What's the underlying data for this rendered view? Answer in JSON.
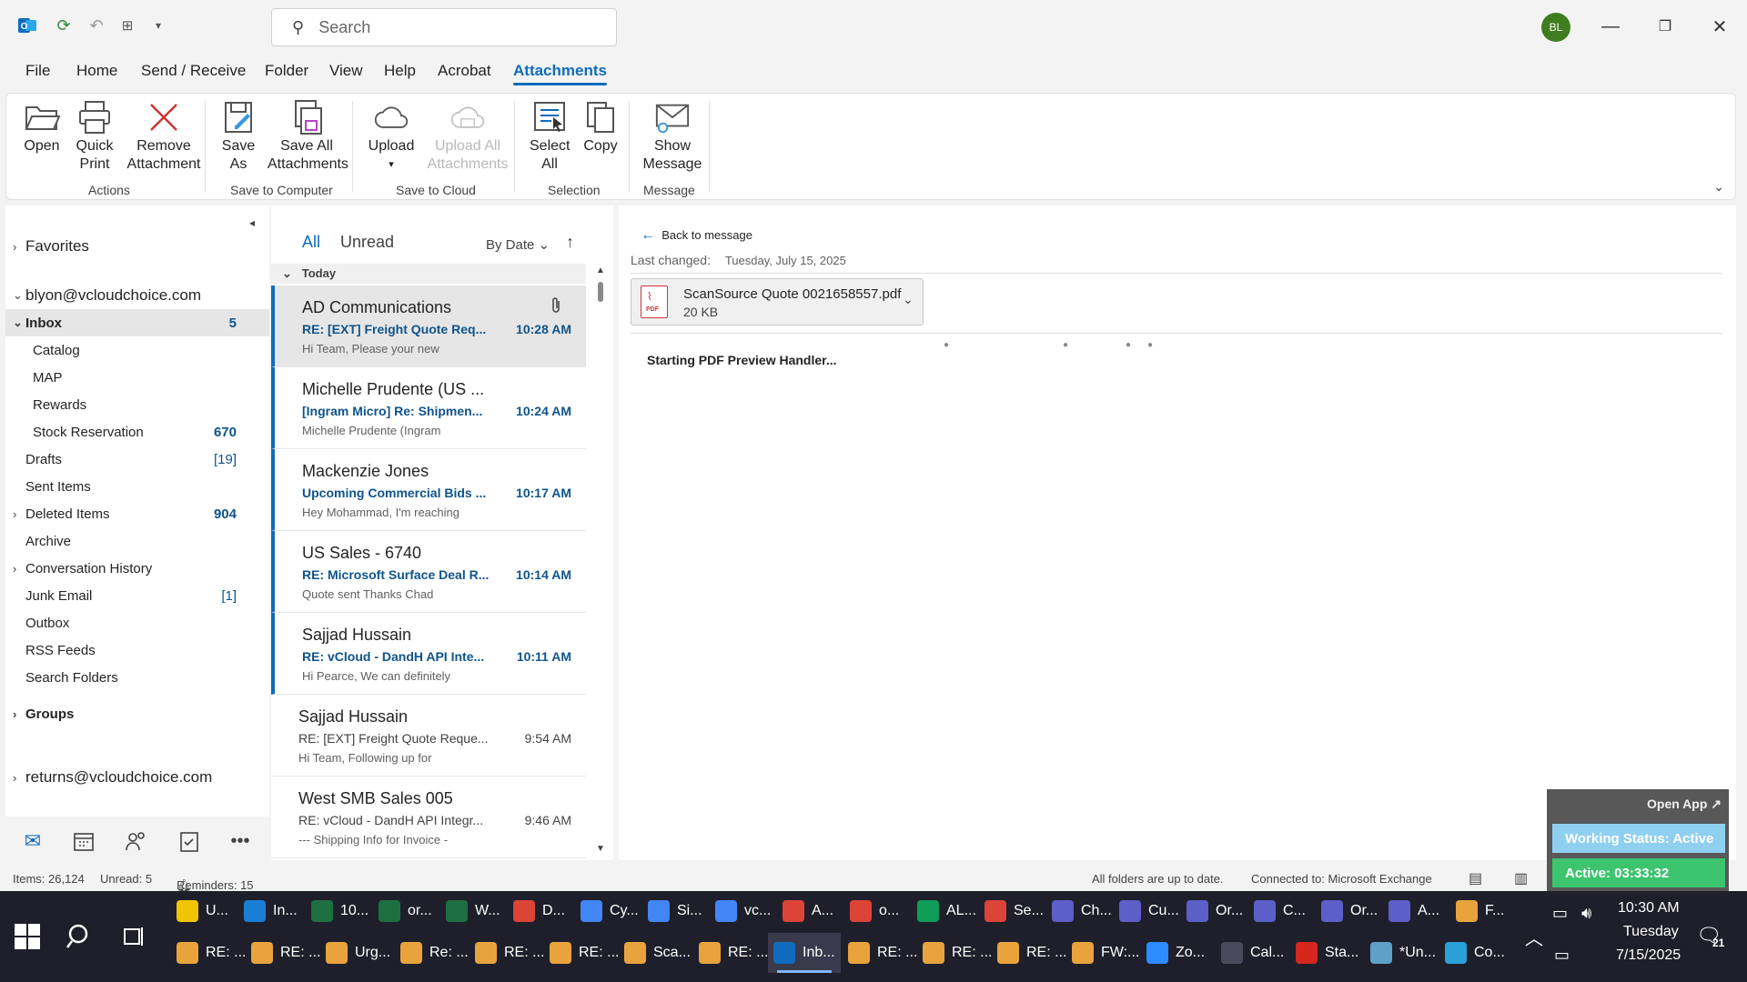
{
  "app": {
    "search_placeholder": "Search",
    "avatar_initials": "BL",
    "accent": "#0f6cbd"
  },
  "menu": [
    "File",
    "Home",
    "Send / Receive",
    "Folder",
    "View",
    "Help",
    "Acrobat",
    "Attachments"
  ],
  "ribbon": {
    "buttons": [
      {
        "label": "Open",
        "icon": "folder-open-icon"
      },
      {
        "label": "Quick Print",
        "icon": "printer-icon"
      },
      {
        "label": "Remove Attachment",
        "icon": "remove-x-icon"
      },
      {
        "label": "Save As",
        "icon": "save-as-icon"
      },
      {
        "label": "Save All Attachments",
        "icon": "save-all-icon"
      },
      {
        "label": "Upload",
        "icon": "cloud-upload-icon"
      },
      {
        "label": "Upload All Attachments",
        "icon": "cloud-upload-all-icon"
      },
      {
        "label": "Select All",
        "icon": "select-all-icon"
      },
      {
        "label": "Copy",
        "icon": "copy-icon"
      },
      {
        "label": "Show Message",
        "icon": "show-message-icon"
      }
    ],
    "groups": [
      "Actions",
      "Save to Computer",
      "Save to Cloud",
      "Selection",
      "Message"
    ]
  },
  "folders": {
    "favorites": "Favorites",
    "account1": "blyon@vcloudchoice.com",
    "items": [
      {
        "label": "Inbox",
        "count": "5"
      },
      {
        "label": "Catalog",
        "count": ""
      },
      {
        "label": "MAP",
        "count": ""
      },
      {
        "label": "Rewards",
        "count": ""
      },
      {
        "label": "Stock Reservation",
        "count": "670"
      },
      {
        "label": "Drafts",
        "count": "[19]"
      },
      {
        "label": "Sent Items",
        "count": ""
      },
      {
        "label": "Deleted Items",
        "count": "904"
      },
      {
        "label": "Archive",
        "count": ""
      },
      {
        "label": "Conversation History",
        "count": ""
      },
      {
        "label": "Junk Email",
        "count": "[1]"
      },
      {
        "label": "Outbox",
        "count": ""
      },
      {
        "label": "RSS Feeds",
        "count": ""
      },
      {
        "label": "Search Folders",
        "count": ""
      }
    ],
    "groups": "Groups",
    "account2": "returns@vcloudchoice.com"
  },
  "list": {
    "tab_all": "All",
    "tab_unread": "Unread",
    "sort": "By Date",
    "group_header": "Today",
    "messages": [
      {
        "from": "AD Communications",
        "subject": "RE: [EXT] Freight Quote Req...",
        "time": "10:28 AM",
        "preview": "Hi Team,    Please your new"
      },
      {
        "from": "Michelle Prudente (US ...",
        "subject": "[Ingram Micro] Re: Shipmen...",
        "time": "10:24 AM",
        "preview": "Michelle Prudente (Ingram"
      },
      {
        "from": "Mackenzie Jones",
        "subject": "Upcoming Commercial Bids ...",
        "time": "10:17 AM",
        "preview": "Hey Mohammad,    I'm reaching"
      },
      {
        "from": "US Sales - 6740",
        "subject": "RE: Microsoft Surface Deal R...",
        "time": "10:14 AM",
        "preview": "Quote sent  Thanks  Chad"
      },
      {
        "from": "Sajjad Hussain",
        "subject": "RE: vCloud - DandH API Inte...",
        "time": "10:11 AM",
        "preview": "Hi Pearce,    We can definitely"
      },
      {
        "from": "Sajjad Hussain",
        "subject": "RE: [EXT] Freight Quote Reque...",
        "time": "9:54 AM",
        "preview": "Hi Team,    Following up for"
      },
      {
        "from": "West SMB Sales 005",
        "subject": "RE: vCloud - DandH API Integr...",
        "time": "9:46 AM",
        "preview": "--- Shipping Info for Invoice -"
      }
    ]
  },
  "reading": {
    "back": "Back to message",
    "last_changed_label": "Last changed:",
    "last_changed_value": "Tuesday, July 15, 2025",
    "file_name": "ScanSource Quote 0021658557.pdf",
    "file_size": "20 KB",
    "pdf_badge": "PDF",
    "handler": "Starting PDF Preview Handler..."
  },
  "status": {
    "items": "Items: 26,124",
    "unread": "Unread: 5",
    "reminders": "Reminders: 15",
    "sync": "All folders are up to date.",
    "connection": "Connected to: Microsoft Exchange"
  },
  "widget": {
    "open_app": "Open App ↗",
    "working": "Working Status: Active",
    "active": "Active: 03:33:32"
  },
  "taskbar": {
    "row1": [
      {
        "label": "U...",
        "icon": "file-explorer-icon",
        "color": "#f0c400"
      },
      {
        "label": "In...",
        "icon": "edge-icon",
        "color": "#1a7fd4"
      },
      {
        "label": "10...",
        "icon": "excel-icon",
        "color": "#1d6f42"
      },
      {
        "label": "or...",
        "icon": "excel-icon",
        "color": "#1d6f42"
      },
      {
        "label": "W...",
        "icon": "excel-icon",
        "color": "#1d6f42"
      },
      {
        "label": "D...",
        "icon": "chrome-icon",
        "color": "#db4437"
      },
      {
        "label": "Cy...",
        "icon": "chrome-icon",
        "color": "#4285f4"
      },
      {
        "label": "Si...",
        "icon": "chrome-icon",
        "color": "#4285f4"
      },
      {
        "label": "vc...",
        "icon": "chrome-icon",
        "color": "#4285f4"
      },
      {
        "label": "A...",
        "icon": "chrome-icon",
        "color": "#db4437"
      },
      {
        "label": "o...",
        "icon": "chrome-icon",
        "color": "#db4437"
      },
      {
        "label": "AL...",
        "icon": "chrome-icon",
        "color": "#0f9d58"
      },
      {
        "label": "Se...",
        "icon": "chrome-icon",
        "color": "#db4437"
      },
      {
        "label": "Ch...",
        "icon": "teams-icon",
        "color": "#5b5fc7"
      },
      {
        "label": "Cu...",
        "icon": "teams-icon",
        "color": "#5b5fc7"
      },
      {
        "label": "Or...",
        "icon": "teams-icon",
        "color": "#5b5fc7"
      },
      {
        "label": "C...",
        "icon": "teams-icon",
        "color": "#5b5fc7"
      },
      {
        "label": "Or...",
        "icon": "teams-icon",
        "color": "#5b5fc7"
      },
      {
        "label": "A...",
        "icon": "teams-icon",
        "color": "#5b5fc7"
      },
      {
        "label": "F...",
        "icon": "mail-icon",
        "color": "#e8a33d"
      }
    ],
    "row2": [
      {
        "label": "RE: ...",
        "icon": "mail-icon",
        "color": "#e8a33d"
      },
      {
        "label": "RE: ...",
        "icon": "mail-icon",
        "color": "#e8a33d"
      },
      {
        "label": "Urg...",
        "icon": "mail-icon",
        "color": "#e8a33d"
      },
      {
        "label": "Re: ...",
        "icon": "mail-icon",
        "color": "#e8a33d"
      },
      {
        "label": "RE: ...",
        "icon": "mail-icon",
        "color": "#e8a33d"
      },
      {
        "label": "RE: ...",
        "icon": "mail-icon",
        "color": "#e8a33d"
      },
      {
        "label": "Sca...",
        "icon": "mail-icon",
        "color": "#e8a33d"
      },
      {
        "label": "RE: ...",
        "icon": "mail-icon",
        "color": "#e8a33d"
      },
      {
        "label": "Inb...",
        "icon": "outlook-icon",
        "color": "#0f6cbd"
      },
      {
        "label": "RE: ...",
        "icon": "mail-icon",
        "color": "#e8a33d"
      },
      {
        "label": "RE: ...",
        "icon": "mail-icon",
        "color": "#e8a33d"
      },
      {
        "label": "RE: ...",
        "icon": "mail-icon",
        "color": "#e8a33d"
      },
      {
        "label": "FW:...",
        "icon": "mail-icon",
        "color": "#e8a33d"
      },
      {
        "label": "Zo...",
        "icon": "zoom-icon",
        "color": "#2d8cff"
      },
      {
        "label": "Cal...",
        "icon": "calculator-icon",
        "color": "#4a4a5a"
      },
      {
        "label": "Sta...",
        "icon": "acrobat-icon",
        "color": "#d4261c"
      },
      {
        "label": "*Un...",
        "icon": "notepad-icon",
        "color": "#5ea0c8"
      },
      {
        "label": "Co...",
        "icon": "app-icon",
        "color": "#2aa0d8"
      }
    ],
    "time": "10:30 AM",
    "day": "Tuesday",
    "date": "7/15/2025",
    "notif_count": "21"
  }
}
